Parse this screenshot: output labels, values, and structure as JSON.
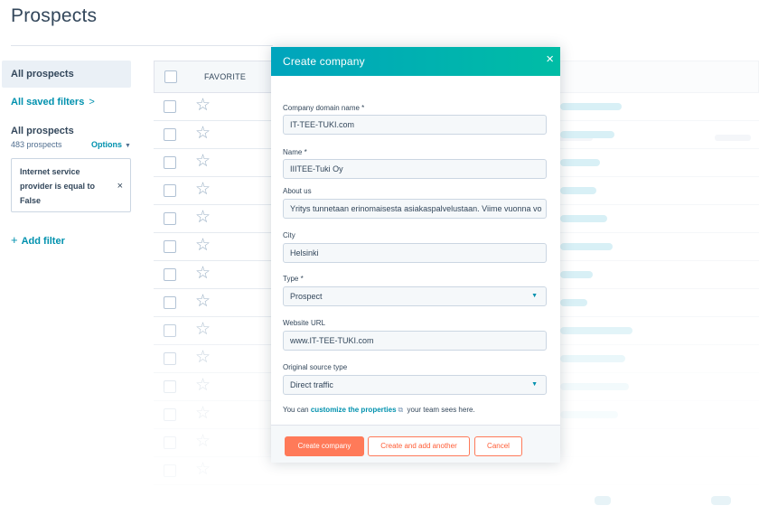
{
  "page": {
    "title": "Prospects"
  },
  "sidebar": {
    "active_item": "All prospects",
    "saved_filters_link": "All saved filters",
    "saved_filters_chevron": ">",
    "view_title": "All prospects",
    "view_count": "483 prospects",
    "options_label": "Options",
    "filter_chip": {
      "text": "Internet service provider is equal to False",
      "close": "×"
    },
    "add_filter": "Add filter",
    "add_filter_icon": "+"
  },
  "table": {
    "favorite_header": "FAVORITE",
    "star_glyph": "☆",
    "row_count": 14
  },
  "modal": {
    "title": "Create company",
    "close_glyph": "×",
    "fields": {
      "domain": {
        "label": "Company domain name *",
        "value": "IT-TEE-TUKI.com"
      },
      "name": {
        "label": "Name *",
        "value": "IIITEE-Tuki Oy"
      },
      "about": {
        "label": "About us",
        "value": "Yritys tunnetaan erinomaisesta asiakaspalvelustaan. Viime vuonna vo"
      },
      "city": {
        "label": "City",
        "value": "Helsinki"
      },
      "type": {
        "label": "Type *",
        "value": "Prospect"
      },
      "website": {
        "label": "Website URL",
        "value": "www.IT-TEE-TUKI.com"
      },
      "source": {
        "label": "Original source type",
        "value": "Direct traffic"
      }
    },
    "helper": {
      "prefix": "You can",
      "link": "customize the properties",
      "suffix": "your team sees here."
    },
    "buttons": {
      "create": "Create company",
      "create_another": "Create and add another",
      "cancel": "Cancel"
    }
  },
  "colors": {
    "header_gradient_start": "#00a4bd",
    "header_gradient_end": "#00bda5",
    "primary_button": "#ff7a59",
    "link": "#0091ae",
    "text": "#33475b"
  }
}
